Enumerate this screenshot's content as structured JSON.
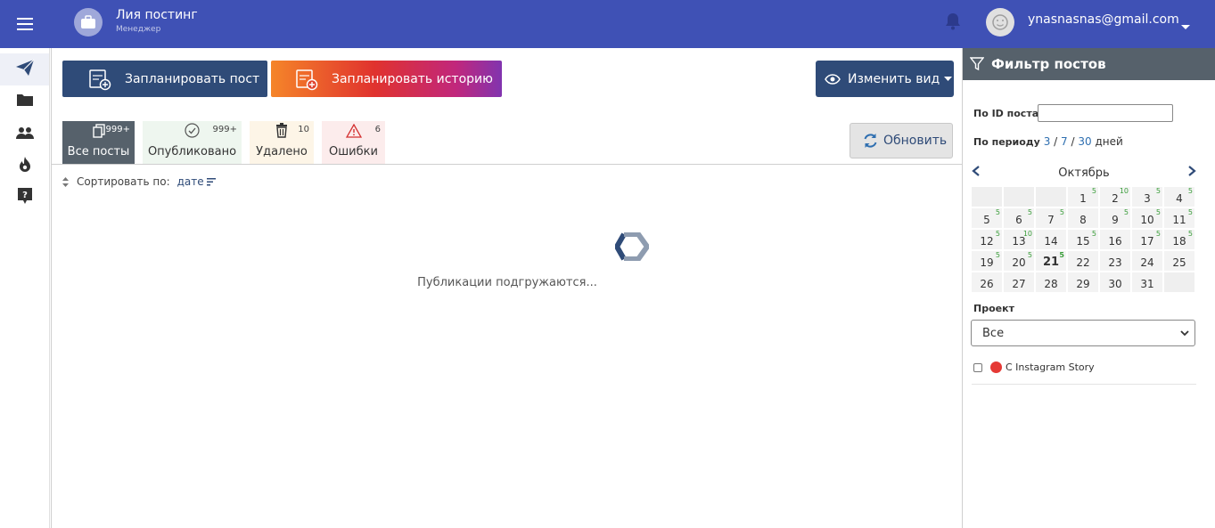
{
  "header": {
    "app_title": "Лия постинг",
    "role": "Менеджер",
    "user_email": "ynasnasnas@gmail.com"
  },
  "toolbar": {
    "plan_post": "Запланировать пост",
    "plan_story": "Запланировать историю",
    "change_view": "Изменить вид",
    "refresh": "Обновить"
  },
  "tabs": [
    {
      "label": "Все посты",
      "count": "999+"
    },
    {
      "label": "Опубликовано",
      "count": "999+"
    },
    {
      "label": "Удалено",
      "count": "10"
    },
    {
      "label": "Ошибки",
      "count": "6"
    }
  ],
  "sort": {
    "label": "Сортировать по:",
    "value": "дате"
  },
  "loading_text": "Публикации подгружаются...",
  "filter": {
    "title": "Фильтр постов",
    "post_id_label": "По ID поста",
    "post_id_value": "",
    "period_label": "По периоду",
    "period_options": [
      "3",
      "7",
      "30"
    ],
    "period_sep": "/",
    "period_unit": "дней",
    "month": "Октябрь",
    "project_label": "Проект",
    "project_value": "Все",
    "insta_label": "С Instagram Story"
  },
  "calendar": [
    {
      "day": "",
      "badge": ""
    },
    {
      "day": "",
      "badge": ""
    },
    {
      "day": "",
      "badge": ""
    },
    {
      "day": "1",
      "badge": "5"
    },
    {
      "day": "2",
      "badge": "10"
    },
    {
      "day": "3",
      "badge": "5"
    },
    {
      "day": "4",
      "badge": "5"
    },
    {
      "day": "5",
      "badge": "5"
    },
    {
      "day": "6",
      "badge": "5"
    },
    {
      "day": "7",
      "badge": "5"
    },
    {
      "day": "8",
      "badge": ""
    },
    {
      "day": "9",
      "badge": "5"
    },
    {
      "day": "10",
      "badge": "5"
    },
    {
      "day": "11",
      "badge": "5"
    },
    {
      "day": "12",
      "badge": "5"
    },
    {
      "day": "13",
      "badge": "10"
    },
    {
      "day": "14",
      "badge": ""
    },
    {
      "day": "15",
      "badge": "5"
    },
    {
      "day": "16",
      "badge": ""
    },
    {
      "day": "17",
      "badge": "5"
    },
    {
      "day": "18",
      "badge": "5"
    },
    {
      "day": "19",
      "badge": "5"
    },
    {
      "day": "20",
      "badge": "5"
    },
    {
      "day": "21",
      "badge": "5",
      "today": true
    },
    {
      "day": "22",
      "badge": ""
    },
    {
      "day": "23",
      "badge": ""
    },
    {
      "day": "24",
      "badge": ""
    },
    {
      "day": "25",
      "badge": ""
    },
    {
      "day": "26",
      "badge": ""
    },
    {
      "day": "27",
      "badge": ""
    },
    {
      "day": "28",
      "badge": ""
    },
    {
      "day": "29",
      "badge": ""
    },
    {
      "day": "30",
      "badge": ""
    },
    {
      "day": "31",
      "badge": ""
    },
    {
      "day": "",
      "badge": ""
    }
  ],
  "icons": {
    "menu": "menu-icon",
    "nav": [
      "send-icon",
      "folder-icon",
      "people-icon",
      "fire-icon",
      "help-icon"
    ],
    "notifications": "bell-icon",
    "filter": "filter-icon"
  },
  "colors": {
    "header": "#3f51b5",
    "primary": "#2f4b78",
    "panel_head": "#56616b",
    "badge": "#3a9d3a"
  }
}
